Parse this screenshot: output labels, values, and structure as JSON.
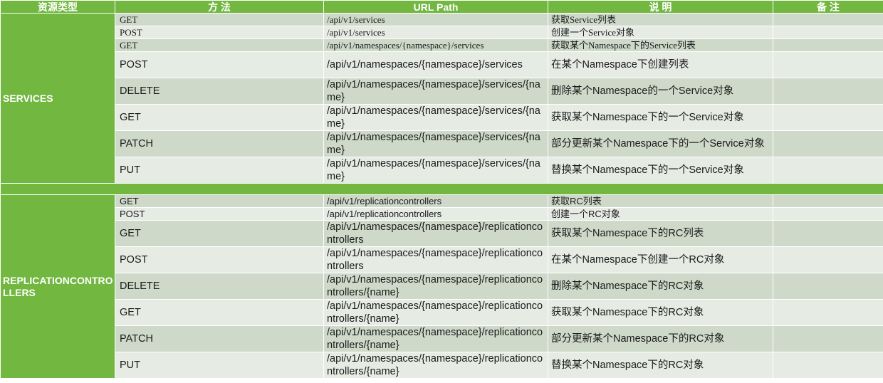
{
  "header": {
    "resource_type": "资源类型",
    "method": "方  法",
    "url_path": "URL Path",
    "description": "说  明",
    "remark": "备  注"
  },
  "groups": [
    {
      "name": "SERVICES",
      "rows": [
        {
          "method": "GET",
          "url": "/api/v1/services",
          "desc": "获取Service列表",
          "remark": ""
        },
        {
          "method": "POST",
          "url": "/api/v1/services",
          "desc": "创建一个Service对象",
          "remark": ""
        },
        {
          "method": "GET",
          "url": "/api/v1/namespaces/{namespace}/services",
          "desc": "获取某个Namespace下的Service列表",
          "remark": ""
        },
        {
          "method": "POST",
          "url": "/api/v1/namespaces/{namespace}/services",
          "desc": "在某个Namespace下创建列表",
          "remark": ""
        },
        {
          "method": "DELETE",
          "url": "/api/v1/namespaces/{namespace}/services/{name}",
          "desc": "删除某个Namespace的一个Service对象",
          "remark": ""
        },
        {
          "method": "GET",
          "url": "/api/v1/namespaces/{namespace}/services/{name}",
          "desc": "获取某个Namespace下的一个Service对象",
          "remark": ""
        },
        {
          "method": "PATCH",
          "url": "/api/v1/namespaces/{namespace}/services/{name}",
          "desc": "部分更新某个Namespace下的一个Service对象",
          "remark": ""
        },
        {
          "method": "PUT",
          "url": "/api/v1/namespaces/{namespace}/services/{name}",
          "desc": "替换某个Namespace下的一个Service对象",
          "remark": ""
        }
      ]
    },
    {
      "name": "REPLICATIONCONTROLLERS",
      "rows": [
        {
          "method": "GET",
          "url": "/api/v1/replicationcontrollers",
          "desc": "获取RC列表",
          "remark": ""
        },
        {
          "method": "POST",
          "url": "/api/v1/replicationcontrollers",
          "desc": "创建一个RC对象",
          "remark": ""
        },
        {
          "method": "GET",
          "url": "/api/v1/namespaces/{namespace}/replicationcontrollers",
          "desc": "获取某个Namespace下的RC列表",
          "remark": ""
        },
        {
          "method": "POST",
          "url": "/api/v1/namespaces/{namespace}/replicationcontrollers",
          "desc": "在某个Namespace下创建一个RC对象",
          "remark": ""
        },
        {
          "method": "DELETE",
          "url": "/api/v1/namespaces/{namespace}/replicationcontrollers/{name}",
          "desc": "删除某个Namespace下的RC对象",
          "remark": ""
        },
        {
          "method": "GET",
          "url": "/api/v1/namespaces/{namespace}/replicationcontrollers/{name}",
          "desc": "获取某个Namespace下的RC对象",
          "remark": ""
        },
        {
          "method": "PATCH",
          "url": "/api/v1/namespaces/{namespace}/replicationcontrollers/{name}",
          "desc": "部分更新某个Namespace下的RC对象",
          "remark": ""
        },
        {
          "method": "PUT",
          "url": "/api/v1/namespaces/{namespace}/replicationcontrollers/{name}",
          "desc": "替换某个Namespace下的RC对象",
          "remark": ""
        }
      ]
    }
  ]
}
